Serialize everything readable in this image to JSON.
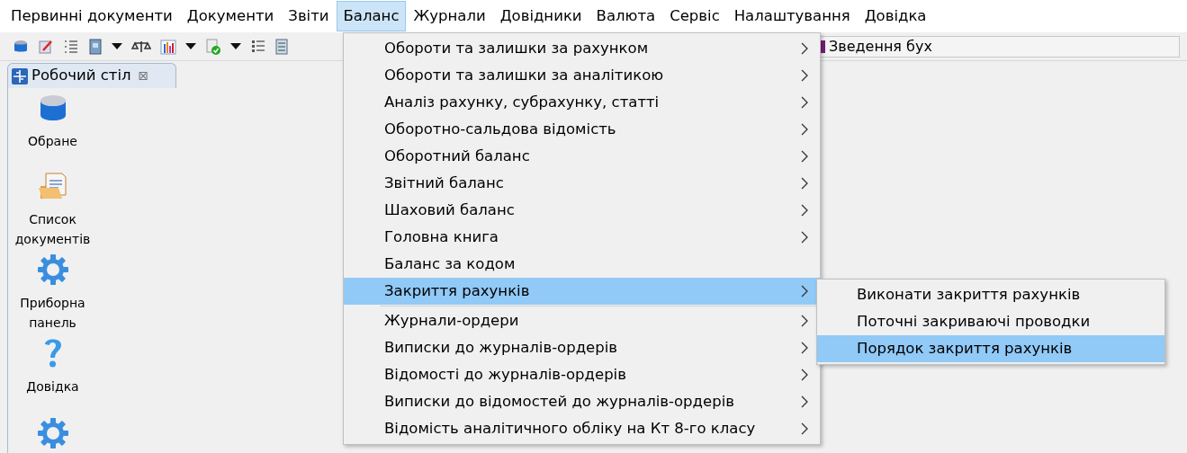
{
  "menubar": [
    {
      "label": "Первинні документи",
      "selected": false
    },
    {
      "label": "Документи",
      "selected": false
    },
    {
      "label": "Звіти",
      "selected": false
    },
    {
      "label": "Баланс",
      "selected": true
    },
    {
      "label": "Журнали",
      "selected": false
    },
    {
      "label": "Довідники",
      "selected": false
    },
    {
      "label": "Валюта",
      "selected": false
    },
    {
      "label": "Сервіс",
      "selected": false
    },
    {
      "label": "Налаштування",
      "selected": false
    },
    {
      "label": "Довідка",
      "selected": false
    }
  ],
  "toolbar": {
    "report_button": "Зведення бух"
  },
  "tab": {
    "label": "Робочий стіл",
    "close": "⊠"
  },
  "desktop": [
    {
      "kind": "favorites",
      "label": "Обране"
    },
    {
      "kind": "documents",
      "label": "Список документів"
    },
    {
      "kind": "gear",
      "label": "Приборна панель"
    },
    {
      "kind": "help",
      "label": "Довідка"
    },
    {
      "kind": "gear"
    }
  ],
  "menu": [
    {
      "kind": "item",
      "label": "Обороти та залишки за рахунком",
      "submenu": true,
      "selected": false
    },
    {
      "kind": "item",
      "label": "Обороти та залишки за аналітикою",
      "submenu": true,
      "selected": false
    },
    {
      "kind": "item",
      "label": "Аналіз рахунку, субрахунку, статті",
      "submenu": true,
      "selected": false
    },
    {
      "kind": "item",
      "label": "Оборотно-сальдова відомість",
      "submenu": true,
      "selected": false
    },
    {
      "kind": "item",
      "label": "Оборотний баланс",
      "submenu": true,
      "selected": false
    },
    {
      "kind": "item",
      "label": "Звітний баланс",
      "submenu": true,
      "selected": false
    },
    {
      "kind": "item",
      "label": "Шаховий баланс",
      "submenu": true,
      "selected": false
    },
    {
      "kind": "item",
      "label": "Головна книга",
      "submenu": true,
      "selected": false
    },
    {
      "kind": "item",
      "label": "Баланс за кодом",
      "submenu": false,
      "selected": false
    },
    {
      "kind": "item",
      "label": "Закриття рахунків",
      "submenu": true,
      "selected": true
    },
    {
      "kind": "separator"
    },
    {
      "kind": "item",
      "label": "Журнали-ордери",
      "submenu": true,
      "selected": false
    },
    {
      "kind": "item",
      "label": "Виписки до журналів-ордерів",
      "submenu": true,
      "selected": false
    },
    {
      "kind": "item",
      "label": "Відомості до журналів-ордерів",
      "submenu": true,
      "selected": false
    },
    {
      "kind": "item",
      "label": "Виписки до відомостей до журналів-ордерів",
      "submenu": true,
      "selected": false
    },
    {
      "kind": "item",
      "label": "Відомість аналітичного обліку на Кт 8-го класу",
      "submenu": true,
      "selected": false
    }
  ],
  "submenu": [
    {
      "label": "Виконати закриття рахунків",
      "selected": false
    },
    {
      "label": "Поточні закриваючі проводки",
      "selected": false
    },
    {
      "label": "Порядок закриття рахунків",
      "selected": true
    }
  ]
}
